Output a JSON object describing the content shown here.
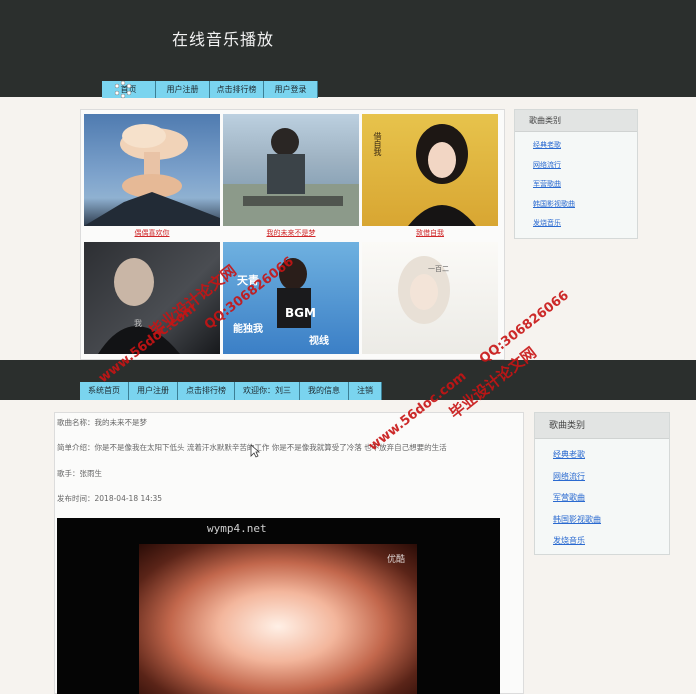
{
  "top": {
    "site_title": "在线音乐播放",
    "nav": [
      {
        "label": "首页"
      },
      {
        "label": "用户注册"
      },
      {
        "label": "点击排行榜"
      },
      {
        "label": "用户登录"
      }
    ],
    "songs": [
      {
        "title": "偶偶喜欢你"
      },
      {
        "title": "我的未来不是梦"
      },
      {
        "title": "致借自我"
      },
      {
        "title": ""
      },
      {
        "title": ""
      },
      {
        "title": ""
      }
    ],
    "thumb_texts": {
      "t3": "借自我",
      "t4": "我",
      "t5_line1": "天青",
      "t5_line2": "BGM",
      "t5_line3": "能独我",
      "t5_line4": "视线",
      "t6": "一百二"
    },
    "sidebar": {
      "title": "歌曲类别",
      "items": [
        "经典老歌",
        "网络流行",
        "军营歌曲",
        "韩国影视歌曲",
        "发烧音乐"
      ]
    }
  },
  "bottom": {
    "nav": [
      {
        "label": "系统首页"
      },
      {
        "label": "用户注册"
      },
      {
        "label": "点击排行榜"
      },
      {
        "label": "欢迎你：刘三"
      },
      {
        "label": "我的信息"
      },
      {
        "label": "注销"
      }
    ],
    "detail": {
      "name": "歌曲名称：我的未来不是梦",
      "intro": "简单介绍：你是不是像我在太阳下低头 流着汗水默默辛苦的工作 你是不是像我就算受了冷落 也不放弃自己想要的生活",
      "singer": "歌手：张雨生",
      "time": "发布时间：2018-04-18 14:35"
    },
    "video": {
      "watermark_site": "wymp4.net",
      "watermark_brand": "优酷"
    },
    "sidebar": {
      "title": "歌曲类别",
      "items": [
        "经典老歌",
        "网络流行",
        "军营歌曲",
        "韩国影视歌曲",
        "发烧音乐"
      ]
    }
  },
  "overlay": {
    "line_a": "毕业设计论文网",
    "line_b": "QQ:306826066",
    "line_c": "www.56doc.com"
  },
  "colors": {
    "header": "#2b2f2d",
    "nav": "#7ad4ef",
    "link_red": "#d0282a",
    "link_blue": "#2a6ad0",
    "watermark_red": "#c81414"
  },
  "icons": {
    "pointer": "arrow-cursor-icon",
    "busy": "loading-spinner-icon"
  }
}
